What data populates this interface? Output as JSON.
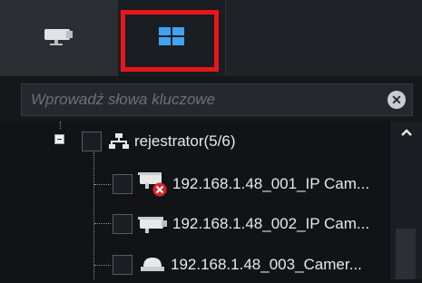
{
  "tabs": [
    {
      "name": "cameras",
      "icon": "camera-icon"
    },
    {
      "name": "layouts",
      "icon": "grid-layout-icon"
    }
  ],
  "search": {
    "placeholder": "Wprowadź słowa kluczowe"
  },
  "tree": {
    "root": {
      "label": "rejestrator(5/6)",
      "icon": "network-icon"
    },
    "children": [
      {
        "label": "192.168.1.48_001_IP Cam...",
        "icon": "camera-offline-icon"
      },
      {
        "label": "192.168.1.48_002_IP Cam...",
        "icon": "bullet-camera-icon"
      },
      {
        "label": "192.168.1.48_003_Camer...",
        "icon": "dome-camera-icon"
      }
    ]
  },
  "colors": {
    "highlight": "#e8161c",
    "layout_icon": "#3fa2f2",
    "error": "#d9242b"
  }
}
